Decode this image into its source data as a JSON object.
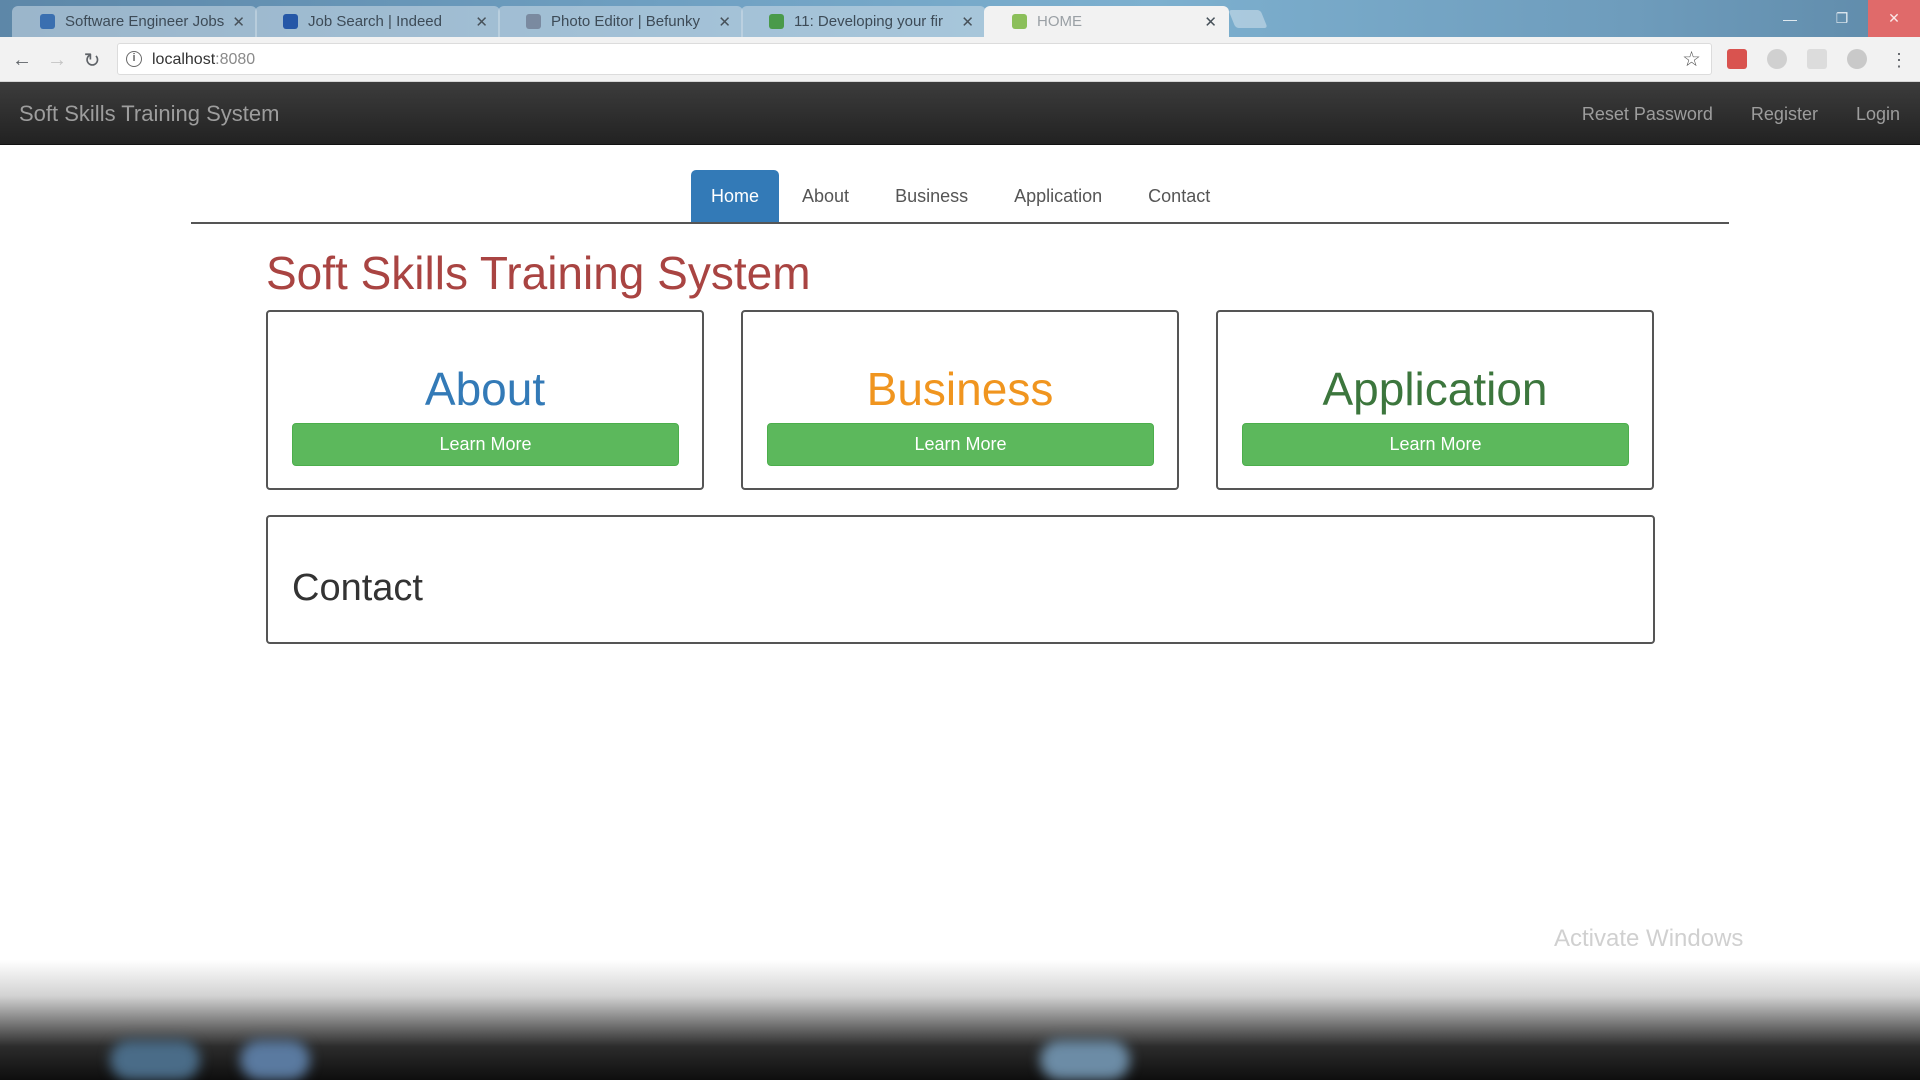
{
  "browser": {
    "tabs": [
      {
        "title": "Software Engineer Jobs",
        "favicon_color": "#3a6fb0",
        "active": false
      },
      {
        "title": "Job Search | Indeed",
        "favicon_color": "#2557a7",
        "active": false
      },
      {
        "title": "Photo Editor | Befunky",
        "favicon_color": "#7a8aa0",
        "active": false
      },
      {
        "title": "11: Developing your fir",
        "favicon_color": "#4a9a4a",
        "active": false
      },
      {
        "title": "HOME",
        "favicon_color": "#8bbf5a",
        "active": true
      }
    ],
    "address": {
      "host": "localhost",
      "port": ":8080"
    },
    "window_controls": [
      "—",
      "❐",
      "✕"
    ]
  },
  "navbar": {
    "brand": "Soft Skills Training System",
    "links": [
      "Reset Password",
      "Register",
      "Login"
    ]
  },
  "tabs": {
    "items": [
      "Home",
      "About",
      "Business",
      "Application",
      "Contact"
    ],
    "active_index": 0
  },
  "main": {
    "title": "Soft Skills Training System",
    "cards": [
      {
        "title": "About",
        "color": "#337ab7",
        "button": "Learn More"
      },
      {
        "title": "Business",
        "color": "#f0951f",
        "button": "Learn More"
      },
      {
        "title": "Application",
        "color": "#3c763d",
        "button": "Learn More"
      }
    ],
    "contact_title": "Contact"
  },
  "overlay": {
    "watermark": "Activate Windows"
  },
  "colors": {
    "title_red": "#a94442",
    "button_green": "#5cb85c",
    "tab_blue": "#337ab7",
    "navbar_dark": "#222222"
  }
}
